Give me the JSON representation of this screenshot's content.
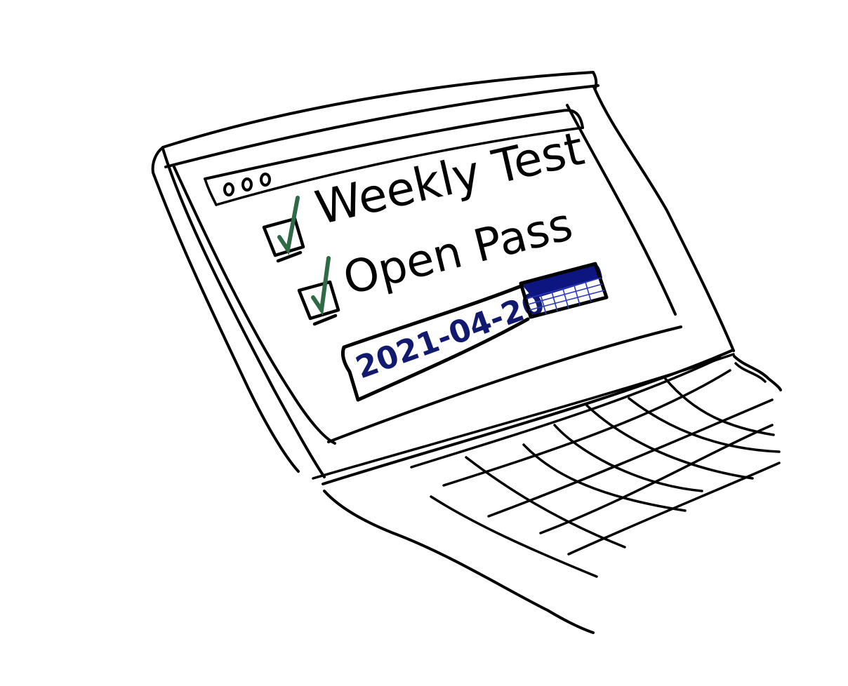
{
  "window": {
    "controls": [
      "window-dot-1",
      "window-dot-2",
      "window-dot-3"
    ]
  },
  "checklist": {
    "items": [
      {
        "label": "Weekly Test",
        "checked": true
      },
      {
        "label": "Open Pass",
        "checked": true
      }
    ]
  },
  "date_field": {
    "value": "2021-04-20",
    "icon": "calendar-icon"
  },
  "colors": {
    "ink": "#000000",
    "check": "#2e6b45",
    "date_text": "#111a6e",
    "calendar_fill": "#0d1580"
  }
}
